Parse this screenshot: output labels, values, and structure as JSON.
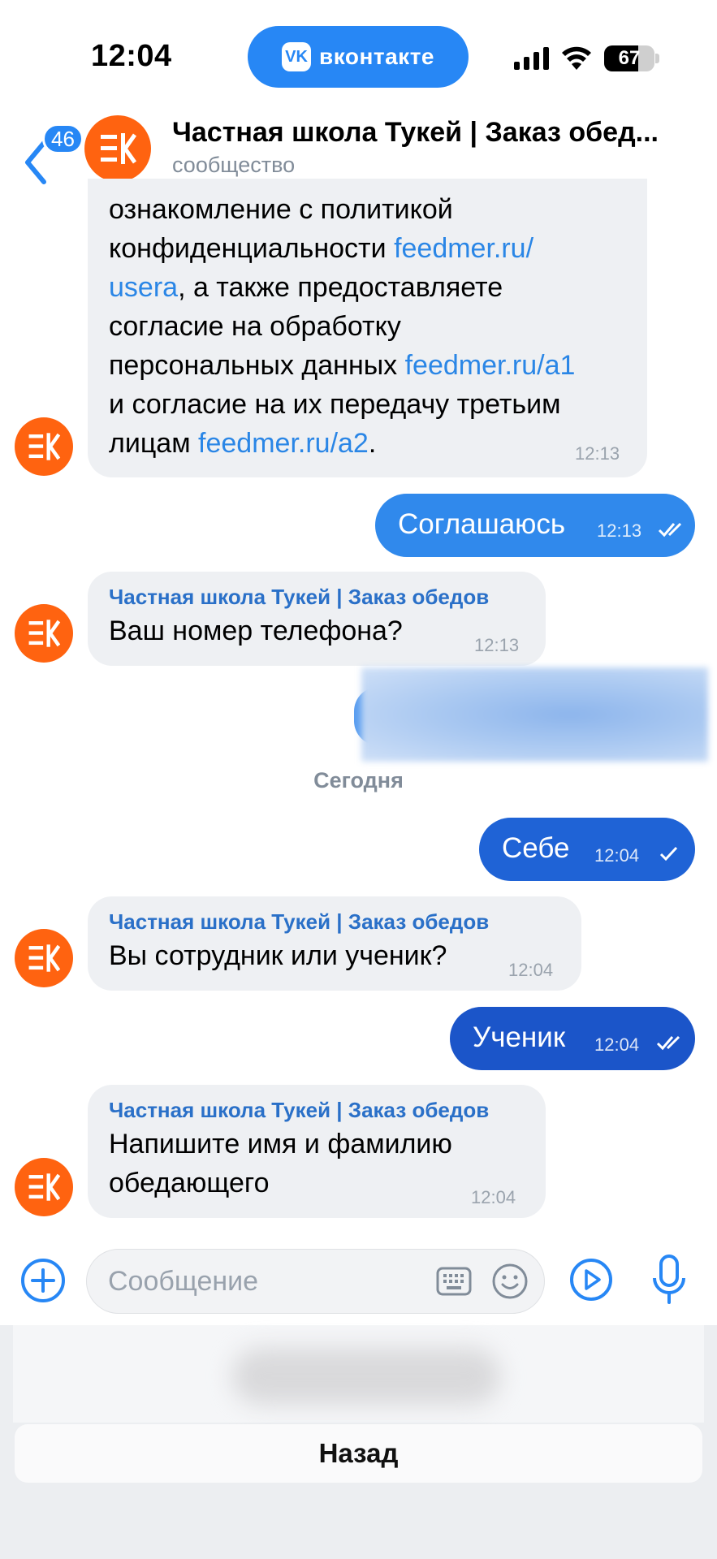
{
  "status_bar": {
    "time": "12:04",
    "app_pill": "вконтакте",
    "vk_logo_text": "VK",
    "battery": "67",
    "battery_level": 0.67
  },
  "header": {
    "back_count": "46",
    "title": "Частная школа Тукей | Заказ обед...",
    "subtitle": "сообщество"
  },
  "messages": {
    "m1": {
      "line1": "ознакомление с политикой",
      "line2a": "конфиденциальности ",
      "link1a": "feedmer.ru/",
      "link1b": "usera",
      "line3": ", а также предоставляете",
      "line4": "согласие на обработку",
      "line5": "персональных данных ",
      "link2": "feedmer.ru/a1",
      "line6": "и согласие на их передачу третьим",
      "line7": "лицам ",
      "link3": "feedmer.ru/a2",
      "line7end": ".",
      "time": "12:13"
    },
    "m2": {
      "text": "Соглашаюсь",
      "time": "12:13"
    },
    "m3": {
      "sender": "Частная школа Тукей | Заказ обедов",
      "text": "Ваш номер телефона?",
      "time": "12:13"
    },
    "day_separator": "Сегодня",
    "m4": {
      "text": "Себе",
      "time": "12:04"
    },
    "m5": {
      "sender": "Частная школа Тукей | Заказ обедов",
      "text": "Вы сотрудник или ученик?",
      "time": "12:04"
    },
    "m6": {
      "text": "Ученик",
      "time": "12:04"
    },
    "m7": {
      "sender": "Частная школа Тукей | Заказ обедов",
      "line1": "Напишите имя и фамилию",
      "line2": "обедающего",
      "time": "12:04"
    }
  },
  "input": {
    "placeholder": "Сообщение"
  },
  "bottom": {
    "back_button": "Назад"
  },
  "colors": {
    "accent": "#2787f5",
    "avatar": "#ff6310",
    "bubble_in": "#eef0f3",
    "bubble_out": "#2b87ea"
  }
}
